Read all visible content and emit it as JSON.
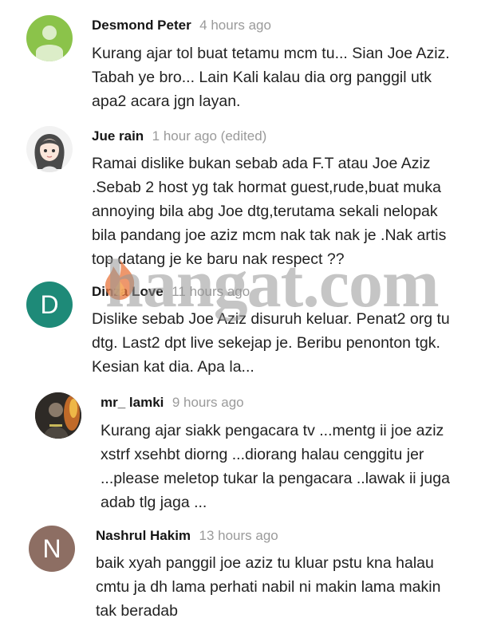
{
  "comments": [
    {
      "author": "Desmond Peter",
      "time": "4 hours ago",
      "text": "Kurang ajar tol buat tetamu mcm tu...  Sian Joe Aziz.\nTabah ye bro... Lain Kali kalau dia org panggil utk\napa2 acara jgn layan.",
      "avatar": {
        "kind": "generic-user-icon",
        "color": "#8bc34a"
      }
    },
    {
      "author": "Jue rain",
      "time": "1 hour ago (edited)",
      "text": "Ramai dislike bukan sebab ada F.T atau Joe Aziz\n.Sebab 2 host yg tak hormat guest,rude,buat muka\nannoying bila abg Joe dtg,terutama sekali nelopak\nbila pandang joe aziz mcm nak tak nak je .Nak artis\ntop datang je ke baru nak respect ??",
      "avatar": {
        "kind": "anime-girl-avatar-icon",
        "color": "#f2f2f2"
      }
    },
    {
      "author": "Dinza Love",
      "time": "11 hours ago",
      "text": "Dislike sebab Joe Aziz disuruh keluar. Penat2 org tu\ndtg. Last2 dpt live sekejap je. Beribu penonton tgk.\nKesian kat dia. Apa la...",
      "avatar": {
        "kind": "letter",
        "letter": "D",
        "color": "#1e8a78"
      }
    },
    {
      "author": "mr_ lamki",
      "time": "9 hours ago",
      "text": "Kurang ajar siakk pengacara tv ...mentg ii joe aziz\nxstrf xsehbt diorng ...diorang halau cenggitu jer\n...please meletop tukar la pengacara ..lawak ii juga\nadab tlg jaga ...",
      "avatar": {
        "kind": "photo-avatar-icon",
        "color": "#3b3530"
      }
    },
    {
      "author": "Nashrul Hakim",
      "time": "13 hours ago",
      "text": "baik xyah panggil joe aziz tu kluar pstu kna halau\ncmtu ja dh lama perhati nabil ni makin lama makin\ntak beradab",
      "avatar": {
        "kind": "letter",
        "letter": "N",
        "color": "#8d6e63"
      }
    }
  ],
  "watermark": {
    "text": "hangat.com",
    "icon": "flame-icon",
    "color": "#e8743b"
  }
}
